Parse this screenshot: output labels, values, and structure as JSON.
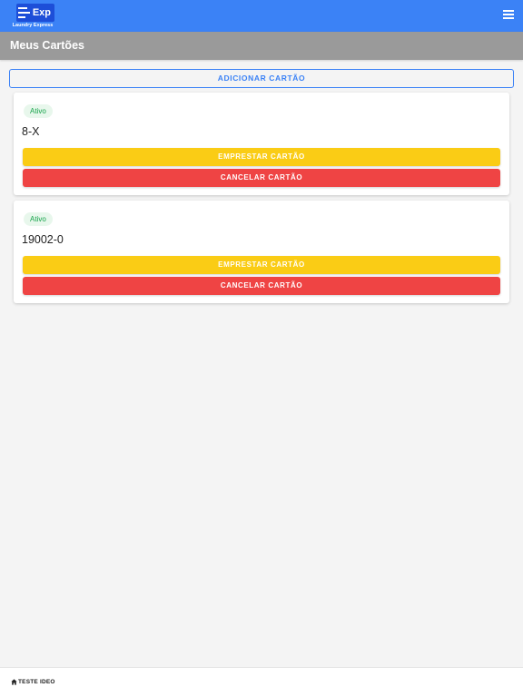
{
  "app": {
    "logo_text": "Exp",
    "logo_subtitle": "Laundry Express",
    "menu_icon": "hamburger-menu-icon",
    "topbar_color": "#3b82f6"
  },
  "page": {
    "title": "Meus Cartões"
  },
  "actions": {
    "add_card_label": "ADICIONAR CARTÃO"
  },
  "cards": [
    {
      "status": "Ativo",
      "number": "8-X",
      "lend_label": "EMPRESTAR CARTÃO",
      "cancel_label": "CANCELAR CARTÃO"
    },
    {
      "status": "Ativo",
      "number": "19002-0",
      "lend_label": "EMPRESTAR CARTÃO",
      "cancel_label": "CANCELAR CARTÃO"
    }
  ],
  "footer": {
    "icon": "home-icon",
    "label": "TESTE IDEO"
  },
  "colors": {
    "accent": "#3b82f6",
    "lend": "#facc15",
    "cancel": "#ef4444",
    "status_active": "#16a34a"
  }
}
